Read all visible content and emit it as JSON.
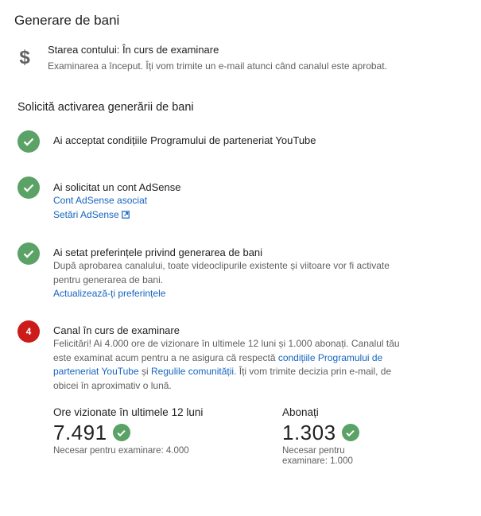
{
  "page": {
    "title": "Generare de bani"
  },
  "account_status": {
    "icon": "dollar-icon",
    "title": "Starea contului: În curs de examinare",
    "subtitle": "Examinarea a început. Îți vom trimite un e-mail atunci când canalul este aprobat."
  },
  "section": {
    "title": "Solicită activarea generării de bani"
  },
  "steps": [
    {
      "status": "done",
      "title": "Ai acceptat condițiile Programului de parteneriat YouTube"
    },
    {
      "status": "done",
      "title": "Ai solicitat un cont AdSense",
      "links": [
        "Cont AdSense asociat",
        "Setări AdSense"
      ]
    },
    {
      "status": "done",
      "title": "Ai setat preferințele privind generarea de bani",
      "desc_line1": "După aprobarea canalului, toate videoclipurile existente și viitoare vor fi activate",
      "desc_line2": "pentru generarea de bani.",
      "link": "Actualizează-ți preferințele"
    },
    {
      "status": "pending",
      "number": "4",
      "title": "Canal în curs de examinare",
      "desc_line1": "Felicitări! Ai 4.000 ore de vizionare în ultimele 12 luni și 1.000 abonați. Canalul tău",
      "desc_line2_a": "este examinat acum pentru a ne asigura că respectă ",
      "link_a_part1": "condițiile Programului de",
      "link_a_part2": "parteneriat YouTube",
      "desc_and": " și ",
      "link_b": "Regulile comunității",
      "desc_line3_b": ". Îți vom trimite decizia prin e-mail, de",
      "desc_line4": "obicei în aproximativ o lună."
    }
  ],
  "metrics": [
    {
      "label": "Ore vizionate în ultimele 12 luni",
      "value": "7.491",
      "req": "Necesar pentru examinare: 4.000"
    },
    {
      "label": "Abonați",
      "value": "1.303",
      "req_line1": "Necesar pentru",
      "req_line2": "examinare: 1.000"
    }
  ],
  "colors": {
    "check": "#5ba266",
    "pending": "#cc1b1b",
    "link": "#1565c0"
  }
}
